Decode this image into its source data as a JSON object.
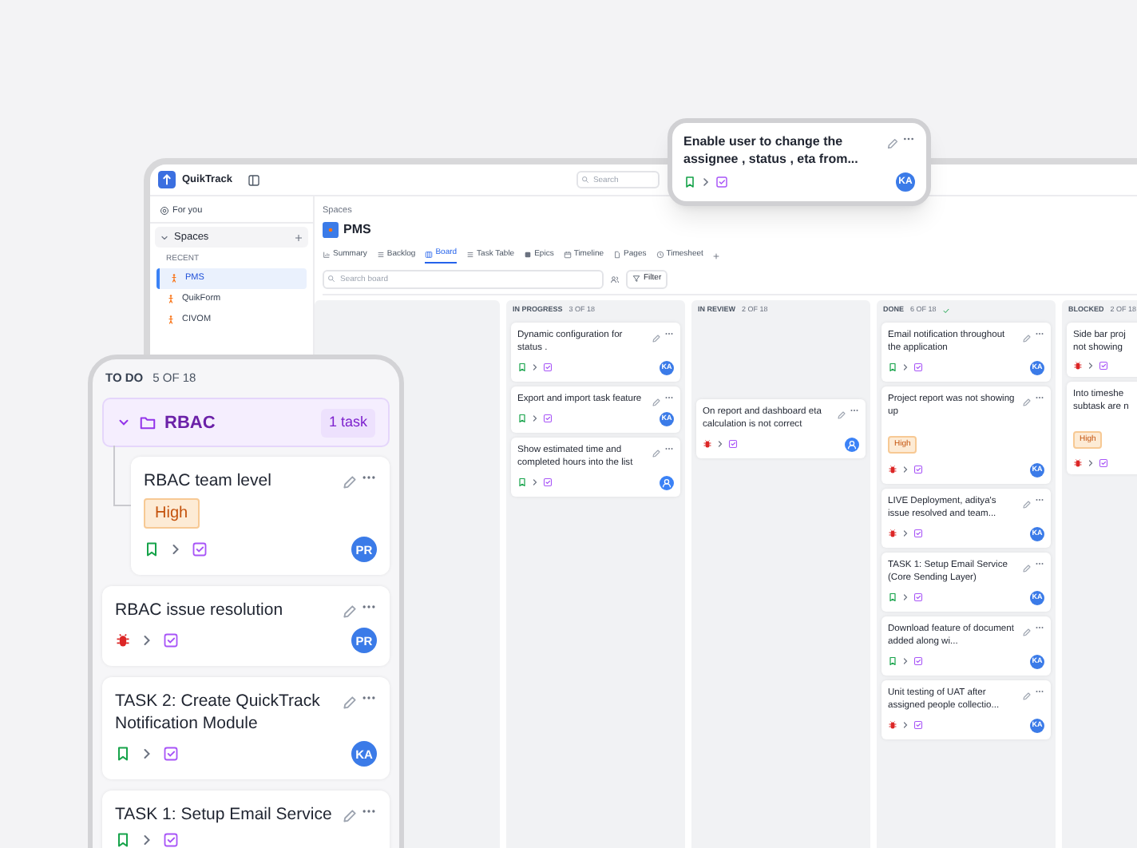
{
  "app": {
    "name": "QuikTrack"
  },
  "top_search": {
    "placeholder": "Search"
  },
  "sidebar": {
    "for_you": "For you",
    "spaces": {
      "label": "Spaces",
      "expanded": true
    },
    "recent_label": "RECENT",
    "items": [
      {
        "label": "PMS",
        "selected": true
      },
      {
        "label": "QuikForm",
        "selected": false
      },
      {
        "label": "CIVOM",
        "selected": false
      }
    ]
  },
  "header": {
    "breadcrumb": "Spaces",
    "title": "PMS"
  },
  "tabs": [
    {
      "label": "Summary",
      "selected": false
    },
    {
      "label": "Backlog",
      "selected": false
    },
    {
      "label": "Board",
      "selected": true
    },
    {
      "label": "Task Table",
      "selected": false
    },
    {
      "label": "Epics",
      "selected": false
    },
    {
      "label": "Timeline",
      "selected": false
    },
    {
      "label": "Pages",
      "selected": false
    },
    {
      "label": "Timesheet",
      "selected": false
    }
  ],
  "board_search": {
    "placeholder": "Search board"
  },
  "filter": "Filter",
  "columns": [
    {
      "title": "IN PROGRESS",
      "count": "3 OF 18",
      "complete": false,
      "cards": [
        {
          "title": "Dynamic configuration for status .",
          "kind": "story",
          "menu": true,
          "assignee": {
            "kind": "initials",
            "text": "KA"
          }
        },
        {
          "title": "Export and import task feature",
          "kind": "story",
          "menu": true,
          "assignee": {
            "kind": "initials",
            "text": "KA"
          }
        },
        {
          "title": "Show estimated time and completed hours into the list",
          "kind": "story",
          "menu": true,
          "assignee": {
            "kind": "person"
          }
        }
      ]
    },
    {
      "title": "IN REVIEW",
      "count": "2 OF 18",
      "complete": false,
      "cards": [
        {
          "title": "On report and dashboard eta calculation is not correct",
          "kind": "bug",
          "menu": true,
          "assignee": {
            "kind": "person"
          }
        }
      ]
    },
    {
      "title": "DONE",
      "count": "6 OF 18",
      "complete": true,
      "cards": [
        {
          "title": "Email notification throughout the application",
          "kind": "story",
          "menu": true,
          "assignee": {
            "kind": "initials",
            "text": "KA"
          }
        },
        {
          "title": "Project report was not showing up",
          "kind": "bug",
          "priority": "High",
          "menu": true,
          "assignee": {
            "kind": "initials",
            "text": "KA"
          }
        },
        {
          "title": "LIVE Deployment, aditya's issue resolved and team...",
          "kind": "bug",
          "menu": true,
          "assignee": {
            "kind": "initials",
            "text": "KA"
          }
        },
        {
          "title": "TASK 1: Setup Email Service (Core Sending Layer)",
          "kind": "story",
          "menu": true,
          "assignee": {
            "kind": "initials",
            "text": "KA"
          }
        },
        {
          "title": "Download feature of document added along wi...",
          "kind": "story",
          "menu": true,
          "assignee": {
            "kind": "initials",
            "text": "KA"
          }
        },
        {
          "title": "Unit testing of UAT after assigned people collectio...",
          "kind": "bug",
          "menu": true,
          "assignee": {
            "kind": "initials",
            "text": "KA"
          }
        }
      ]
    },
    {
      "title": "BLOCKED",
      "count": "2 OF 18",
      "complete": false,
      "cards": [
        {
          "title": "Side bar proj\nnot showing",
          "kind": "bug",
          "menu": false
        },
        {
          "title": "Into timeshe\nsubtask are n",
          "kind": "bug",
          "priority": "High",
          "menu": false
        }
      ]
    }
  ],
  "floating_card": {
    "title": "Enable user to change the assignee , status , eta from...",
    "kind": "story",
    "menu": true,
    "assignee": {
      "kind": "initials",
      "text": "KA"
    }
  },
  "todo_panel": {
    "title": "TO DO",
    "count": "5 OF 18",
    "group": {
      "label": "RBAC",
      "expanded": true,
      "count": "1 task",
      "cards": [
        {
          "title": "RBAC team level",
          "kind": "story",
          "priority": "High",
          "menu": true,
          "assignee": {
            "kind": "initials",
            "text": "PR"
          }
        }
      ]
    },
    "cards": [
      {
        "title": "RBAC issue resolution",
        "kind": "bug",
        "menu": true,
        "assignee": {
          "kind": "initials",
          "text": "PR"
        }
      },
      {
        "title": "TASK 2: Create QuickTrack Notification Module",
        "kind": "story",
        "menu": true,
        "assignee": {
          "kind": "initials",
          "text": "KA"
        }
      },
      {
        "title": "TASK 1: Setup Email Service",
        "kind": "story",
        "menu": true
      }
    ]
  }
}
